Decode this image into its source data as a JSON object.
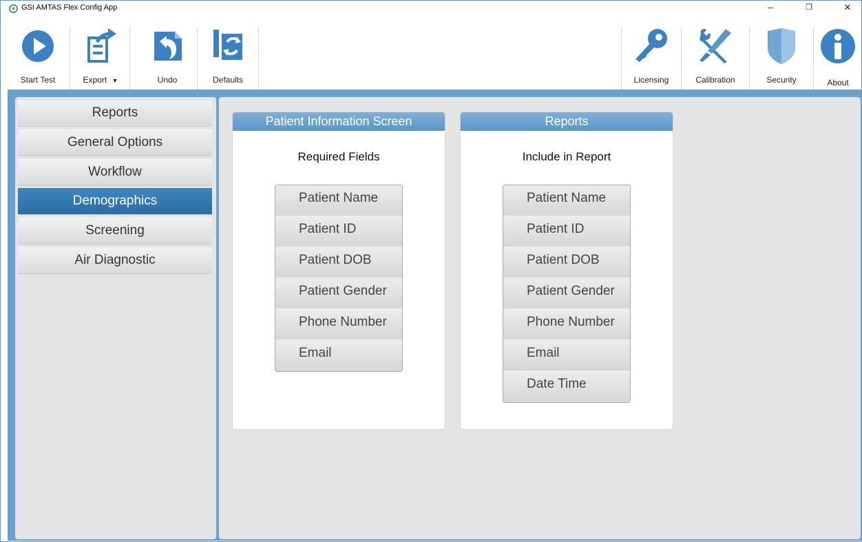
{
  "window": {
    "title": "GSI AMTAS Flex Config App",
    "minimize": "–",
    "restore": "❐",
    "close": "✕"
  },
  "toolbar": {
    "start_test": "Start Test",
    "export": "Export",
    "undo": "Undo",
    "defaults": "Defaults",
    "licensing": "Licensing",
    "calibration": "Calibration",
    "security": "Security",
    "about": "About"
  },
  "sidebar": {
    "items": [
      {
        "label": "Reports",
        "active": false
      },
      {
        "label": "General Options",
        "active": false
      },
      {
        "label": "Workflow",
        "active": false
      },
      {
        "label": "Demographics",
        "active": true
      },
      {
        "label": "Screening",
        "active": false
      },
      {
        "label": "Air Diagnostic",
        "active": false
      }
    ]
  },
  "panels": {
    "patient_info": {
      "header": "Patient Information Screen",
      "subtitle": "Required Fields",
      "fields": [
        "Patient Name",
        "Patient ID",
        "Patient DOB",
        "Patient Gender",
        "Phone Number",
        "Email"
      ]
    },
    "reports": {
      "header": "Reports",
      "subtitle": "Include in Report",
      "fields": [
        "Patient Name",
        "Patient ID",
        "Patient DOB",
        "Patient Gender",
        "Phone Number",
        "Email",
        "Date Time"
      ]
    }
  },
  "colors": {
    "accent": "#2f77b2",
    "frame": "#6aa0cc",
    "panel_bg": "#e4e4e4"
  }
}
